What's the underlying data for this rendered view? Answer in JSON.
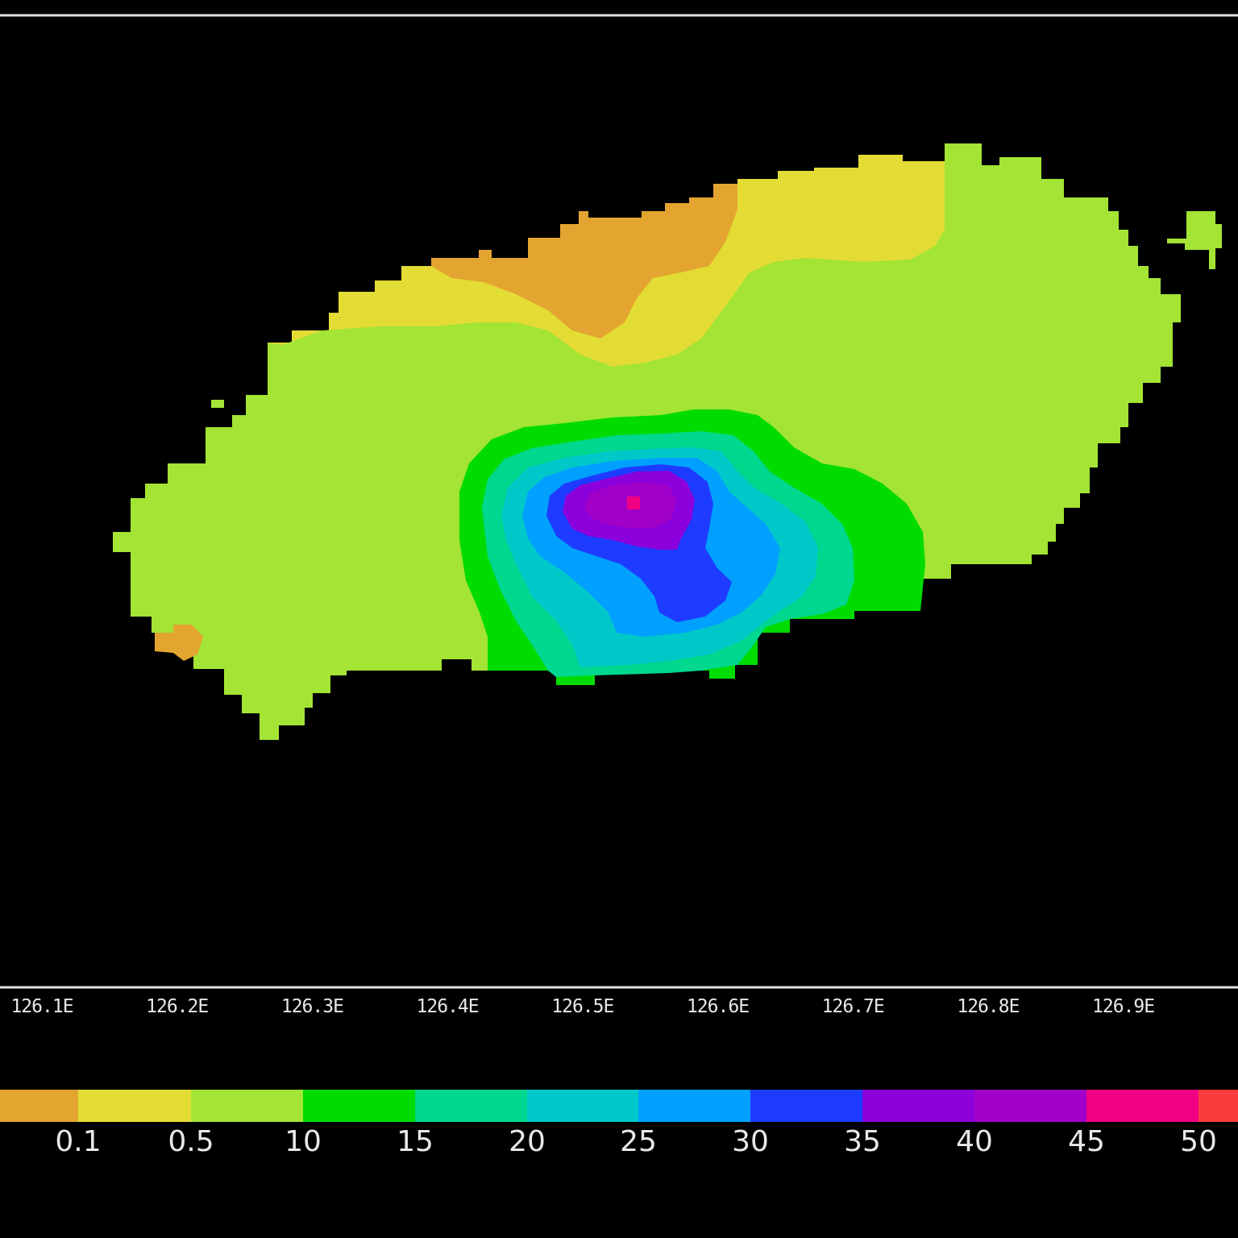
{
  "map": {
    "x_axis": {
      "ticks": [
        "126.1E",
        "126.2E",
        "126.3E",
        "126.4E",
        "126.5E",
        "126.6E",
        "126.7E",
        "126.8E",
        "126.9E"
      ]
    }
  },
  "colorbar": {
    "bins": [
      {
        "color": "#e3a530"
      },
      {
        "color": "#e3dc35"
      },
      {
        "color": "#a3e435"
      },
      {
        "color": "#00dc00"
      },
      {
        "color": "#00d78f"
      },
      {
        "color": "#00c8c8"
      },
      {
        "color": "#00a0ff"
      },
      {
        "color": "#1e3cff"
      },
      {
        "color": "#8c00dc"
      },
      {
        "color": "#a000c8"
      },
      {
        "color": "#f00082"
      },
      {
        "color": "#fa3c3c"
      }
    ],
    "labels": [
      "0.1",
      "0.5",
      "10",
      "15",
      "20",
      "25",
      "30",
      "35",
      "40",
      "45",
      "50"
    ]
  }
}
